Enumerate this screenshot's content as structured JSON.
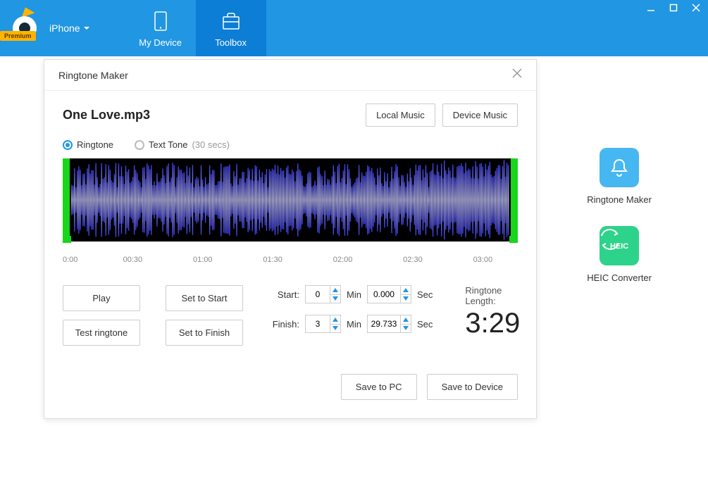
{
  "header": {
    "premium_label": "Premium",
    "device_name": "iPhone",
    "tabs": {
      "my_device": "My Device",
      "toolbox": "Toolbox"
    }
  },
  "side_tools": {
    "ringtone_maker": "Ringtone Maker",
    "heic_converter": "HEIC Converter",
    "heic_badge": "HEIC"
  },
  "modal": {
    "title": "Ringtone Maker",
    "file_name": "One Love.mp3",
    "local_music_btn": "Local Music",
    "device_music_btn": "Device Music",
    "radio_ringtone": "Ringtone",
    "radio_texttone": "Text Tone",
    "radio_texttone_hint": "(30 secs)",
    "time_ticks": [
      "0:00",
      "00:30",
      "01:00",
      "01:30",
      "02:00",
      "02:30",
      "03:00"
    ],
    "play_btn": "Play",
    "test_btn": "Test ringtone",
    "set_start_btn": "Set to Start",
    "set_finish_btn": "Set to Finish",
    "start_label": "Start:",
    "finish_label": "Finish:",
    "min_unit": "Min",
    "sec_unit": "Sec",
    "start_min": "0",
    "start_sec": "0.000",
    "finish_min": "3",
    "finish_sec": "29.733",
    "length_label": "Ringtone Length:",
    "length_value": "3:29",
    "save_pc_btn": "Save to PC",
    "save_device_btn": "Save to Device"
  }
}
